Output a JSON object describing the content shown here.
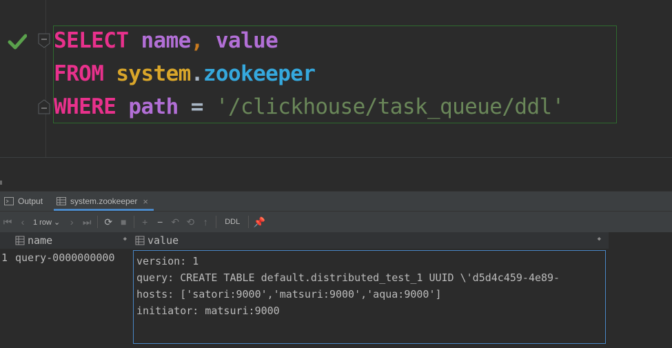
{
  "editor": {
    "lines": [
      [
        {
          "t": "SELECT",
          "c": "kw"
        },
        {
          "t": " ",
          "c": "plain"
        },
        {
          "t": "name",
          "c": "id"
        },
        {
          "t": ",",
          "c": "op"
        },
        {
          "t": " ",
          "c": "plain"
        },
        {
          "t": "value",
          "c": "id"
        }
      ],
      [
        {
          "t": "FROM",
          "c": "kw"
        },
        {
          "t": " ",
          "c": "plain"
        },
        {
          "t": "system",
          "c": "tbl"
        },
        {
          "t": ".",
          "c": "plain"
        },
        {
          "t": "zookeeper",
          "c": "tbl2"
        }
      ],
      [
        {
          "t": "WHERE",
          "c": "kw"
        },
        {
          "t": " ",
          "c": "plain"
        },
        {
          "t": "path",
          "c": "id"
        },
        {
          "t": " = ",
          "c": "plain"
        },
        {
          "t": "'/clickhouse/task_queue/ddl'",
          "c": "str"
        }
      ]
    ],
    "status_icon": "check-icon"
  },
  "tabs": {
    "output_label": "Output",
    "result_label": "system.zookeeper",
    "close_glyph": "×"
  },
  "toolbar": {
    "rows_label": "1 row",
    "ddl_label": "DDL"
  },
  "grid": {
    "columns": [
      "name",
      "value"
    ],
    "rows": [
      {
        "num": "1",
        "name": "query-0000000000",
        "value_lines": [
          "version: 1",
          "query: CREATE TABLE default.distributed_test_1 UUID \\'d5d4c459-4e89-",
          "hosts: ['satori:9000','matsuri:9000','aqua:9000']",
          "initiator: matsuri:9000"
        ]
      }
    ]
  },
  "colors": {
    "keyword": "#e8318c",
    "identifier": "#b26fd6",
    "table_system": "#d9a62a",
    "table_name": "#35a8dd",
    "string": "#6a8759",
    "success": "#5aa14c",
    "selection": "#4a88c7"
  }
}
